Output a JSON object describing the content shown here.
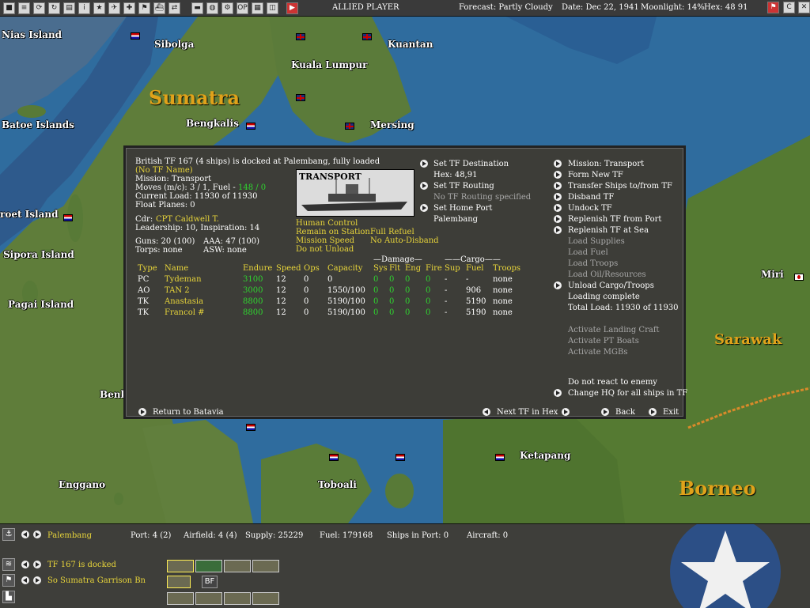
{
  "topbar": {
    "player": "ALLIED PLAYER",
    "forecast": "Forecast: Partly Cloudy",
    "date": "Date: Dec 22, 1941",
    "moonlight": "Moonlight: 14%",
    "hex": "Hex: 48 91",
    "op_label": "OP",
    "right_icons": [
      "flag-icon",
      "c-icon",
      "x-icon"
    ]
  },
  "map": {
    "labels": [
      "Nias Island",
      "Sibolga",
      "Sumatra",
      "Batoe Islands",
      "Bengkalis",
      "Kuala Lumpur",
      "Kuantan",
      "Mersing",
      "roet Island",
      "Sipora Island",
      "Pagai Island",
      "Benk",
      "Enggano",
      "Toboali",
      "Ketapang",
      "Miri",
      "Sarawak",
      "Borneo"
    ]
  },
  "dialog": {
    "header": "British TF 167 (4 ships) is docked at Palembang, fully loaded",
    "tf_name": "(No TF Name)",
    "mission": "Mission: Transport",
    "moves_prefix": "Moves (m/c): 3 / 1, Fuel - ",
    "moves_fuel": "148 / 0",
    "current_load": "Current Load: 11930 of 11930",
    "float_planes": "Float Planes: 0",
    "cdr_label": "Cdr:",
    "cdr_name": "CPT Caldwell T.",
    "leadership": "Leadership: 10, Inspiration: 14",
    "guns": "Guns: 20 (100)",
    "aaa": "AAA: 47 (100)",
    "torps": "Torps: none",
    "asw": "ASW: none",
    "ship_type_title": "TRANSPORT",
    "control": [
      "Human Control",
      "Remain on Station",
      "Mission Speed",
      "Do not Unload"
    ],
    "control2": [
      "Full Refuel",
      "No Auto-Disband"
    ],
    "mid_actions": {
      "set_dest": "Set TF Destination",
      "hex": "Hex: 48,91",
      "set_routing": "Set TF Routing",
      "no_routing": "No TF Routing specified",
      "set_home": "Set Home Port",
      "home_port": "Palembang"
    },
    "right_actions": [
      {
        "label": "Mission: Transport",
        "arrow": true,
        "dim": false
      },
      {
        "label": "Form New TF",
        "arrow": true,
        "dim": false
      },
      {
        "label": "Transfer Ships to/from TF",
        "arrow": true,
        "dim": false
      },
      {
        "label": "Disband TF",
        "arrow": true,
        "dim": false
      },
      {
        "label": "Undock TF",
        "arrow": true,
        "dim": false
      },
      {
        "label": "Replenish TF from Port",
        "arrow": true,
        "dim": false
      },
      {
        "label": "Replenish TF at Sea",
        "arrow": true,
        "dim": false
      },
      {
        "label": "Load Supplies",
        "arrow": false,
        "dim": true
      },
      {
        "label": "Load Fuel",
        "arrow": false,
        "dim": true
      },
      {
        "label": "Load Troops",
        "arrow": false,
        "dim": true
      },
      {
        "label": "Load Oil/Resources",
        "arrow": false,
        "dim": true
      },
      {
        "label": "Unload Cargo/Troops",
        "arrow": true,
        "dim": false
      },
      {
        "label": "Loading complete",
        "arrow": false,
        "dim": false
      },
      {
        "label": "Total Load: 11930 of 11930",
        "arrow": false,
        "dim": false
      }
    ],
    "craft_actions": [
      "Activate Landing Craft",
      "Activate PT Boats",
      "Activate MGBs"
    ],
    "react": "Do not react to enemy",
    "change_hq": "Change HQ for all ships in TF",
    "damage_header": "Damage",
    "cargo_header": "Cargo",
    "columns": [
      "Type",
      "Name",
      "Endure",
      "Speed",
      "Ops",
      "Capacity",
      "Sys",
      "Flt",
      "Eng",
      "Fire",
      "Sup",
      "Fuel",
      "Troops"
    ],
    "ships": [
      {
        "type": "PC",
        "name": "Tydeman",
        "endure": "3100",
        "speed": "12",
        "ops": "0",
        "capacity": "0",
        "sys": "0",
        "flt": "0",
        "eng": "0",
        "fire": "0",
        "sup": "-",
        "fuel": "-",
        "troops": "none"
      },
      {
        "type": "AO",
        "name": "TAN 2",
        "endure": "3000",
        "speed": "12",
        "ops": "0",
        "capacity": "1550/100",
        "sys": "0",
        "flt": "0",
        "eng": "0",
        "fire": "0",
        "sup": "-",
        "fuel": "906",
        "troops": "none"
      },
      {
        "type": "TK",
        "name": "Anastasia",
        "endure": "8800",
        "speed": "12",
        "ops": "0",
        "capacity": "5190/100",
        "sys": "0",
        "flt": "0",
        "eng": "0",
        "fire": "0",
        "sup": "-",
        "fuel": "5190",
        "troops": "none"
      },
      {
        "type": "TK",
        "name": "Francol #",
        "endure": "8800",
        "speed": "12",
        "ops": "0",
        "capacity": "5190/100",
        "sys": "0",
        "flt": "0",
        "eng": "0",
        "fire": "0",
        "sup": "-",
        "fuel": "5190",
        "troops": "none"
      }
    ],
    "return": "Return to Batavia",
    "next_tf": "Next TF in Hex",
    "back": "Back",
    "exit": "Exit"
  },
  "bottom": {
    "base": "Palembang",
    "port": "Port: 4 (2)",
    "airfield": "Airfield: 4 (4)",
    "supply": "Supply: 25229",
    "fuel": "Fuel: 179168",
    "ships_in_port": "Ships in Port: 0",
    "aircraft": "Aircraft: 0",
    "tf_status": "TF 167 is docked",
    "unit": "So Sumatra Garrison Bn",
    "bf_label": "BF"
  }
}
